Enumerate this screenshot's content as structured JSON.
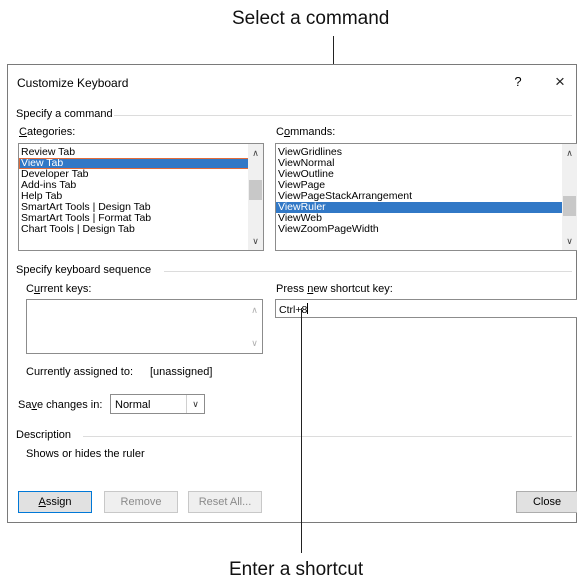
{
  "callouts": {
    "top": "Select a command",
    "bottom": "Enter a shortcut"
  },
  "dialog": {
    "title": "Customize Keyboard",
    "help": "?",
    "close_icon": "×"
  },
  "command_group": {
    "label": "Specify a command",
    "categories_label_key": "C",
    "categories_label_rest": "ategories:",
    "commands_label_pre": "C",
    "commands_label_key": "o",
    "commands_label_rest": "mmands:",
    "categories": [
      "Review Tab",
      "View Tab",
      "Developer Tab",
      "Add-ins Tab",
      "Help Tab",
      "SmartArt Tools | Design Tab",
      "SmartArt Tools | Format Tab",
      "Chart Tools | Design Tab"
    ],
    "categories_selected_index": 1,
    "commands": [
      "ViewGridlines",
      "ViewNormal",
      "ViewOutline",
      "ViewPage",
      "ViewPageStackArrangement",
      "ViewRuler",
      "ViewWeb",
      "ViewZoomPageWidth"
    ],
    "commands_selected_index": 5
  },
  "keyboard_group": {
    "label": "Specify keyboard sequence",
    "current_keys_label_pre": "C",
    "current_keys_label_key": "u",
    "current_keys_label_rest": "rrent keys:",
    "new_key_label_pre": "Press ",
    "new_key_label_key": "n",
    "new_key_label_rest": "ew shortcut key:",
    "new_key_value": "Ctrl+8",
    "assigned_label": "Currently assigned to:",
    "assigned_value": "[unassigned]"
  },
  "save": {
    "label_pre": "Sa",
    "label_key": "v",
    "label_rest": "e changes in:",
    "value": "Normal"
  },
  "description": {
    "label": "Description",
    "text": "Shows or hides the ruler"
  },
  "buttons": {
    "assign_key": "A",
    "assign_rest": "ssign",
    "remove": "Remove",
    "reset_all": "Reset All...",
    "close": "Close"
  },
  "icons": {
    "scroll_up": "▲",
    "scroll_down": "▼",
    "dropdown": "chevron-down-icon"
  }
}
